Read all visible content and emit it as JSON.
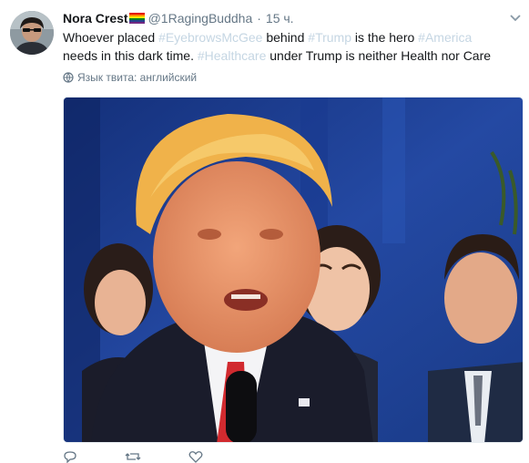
{
  "tweet": {
    "author_name": "Nora Crest",
    "handle": "@1RagingBuddha",
    "separator": "·",
    "time": "15 ч.",
    "text_parts": [
      {
        "text": "Whoever placed ",
        "hashtag": false
      },
      {
        "text": "#EyebrowsMcGee",
        "hashtag": true
      },
      {
        "text": " behind ",
        "hashtag": false
      },
      {
        "text": "#Trump",
        "hashtag": true
      },
      {
        "text": " is the hero ",
        "hashtag": false
      },
      {
        "text": "#America",
        "hashtag": true
      },
      {
        "text": " needs in this dark time. ",
        "hashtag": false
      },
      {
        "text": "#Healthcare",
        "hashtag": true
      },
      {
        "text": " under Trump is neither Health nor Care",
        "hashtag": false
      }
    ],
    "language_label": "Язык твита: английский"
  },
  "colors": {
    "name": "#14171a",
    "meta": "#657786",
    "hashtag": "#c5d6e3",
    "photo_background": "#1d3f8f"
  },
  "icons": {
    "flag": "rainbow-flag-icon",
    "caret": "chevron-down-icon",
    "globe": "globe-icon",
    "reply": "reply-icon",
    "retweet": "retweet-icon",
    "like": "heart-icon"
  }
}
